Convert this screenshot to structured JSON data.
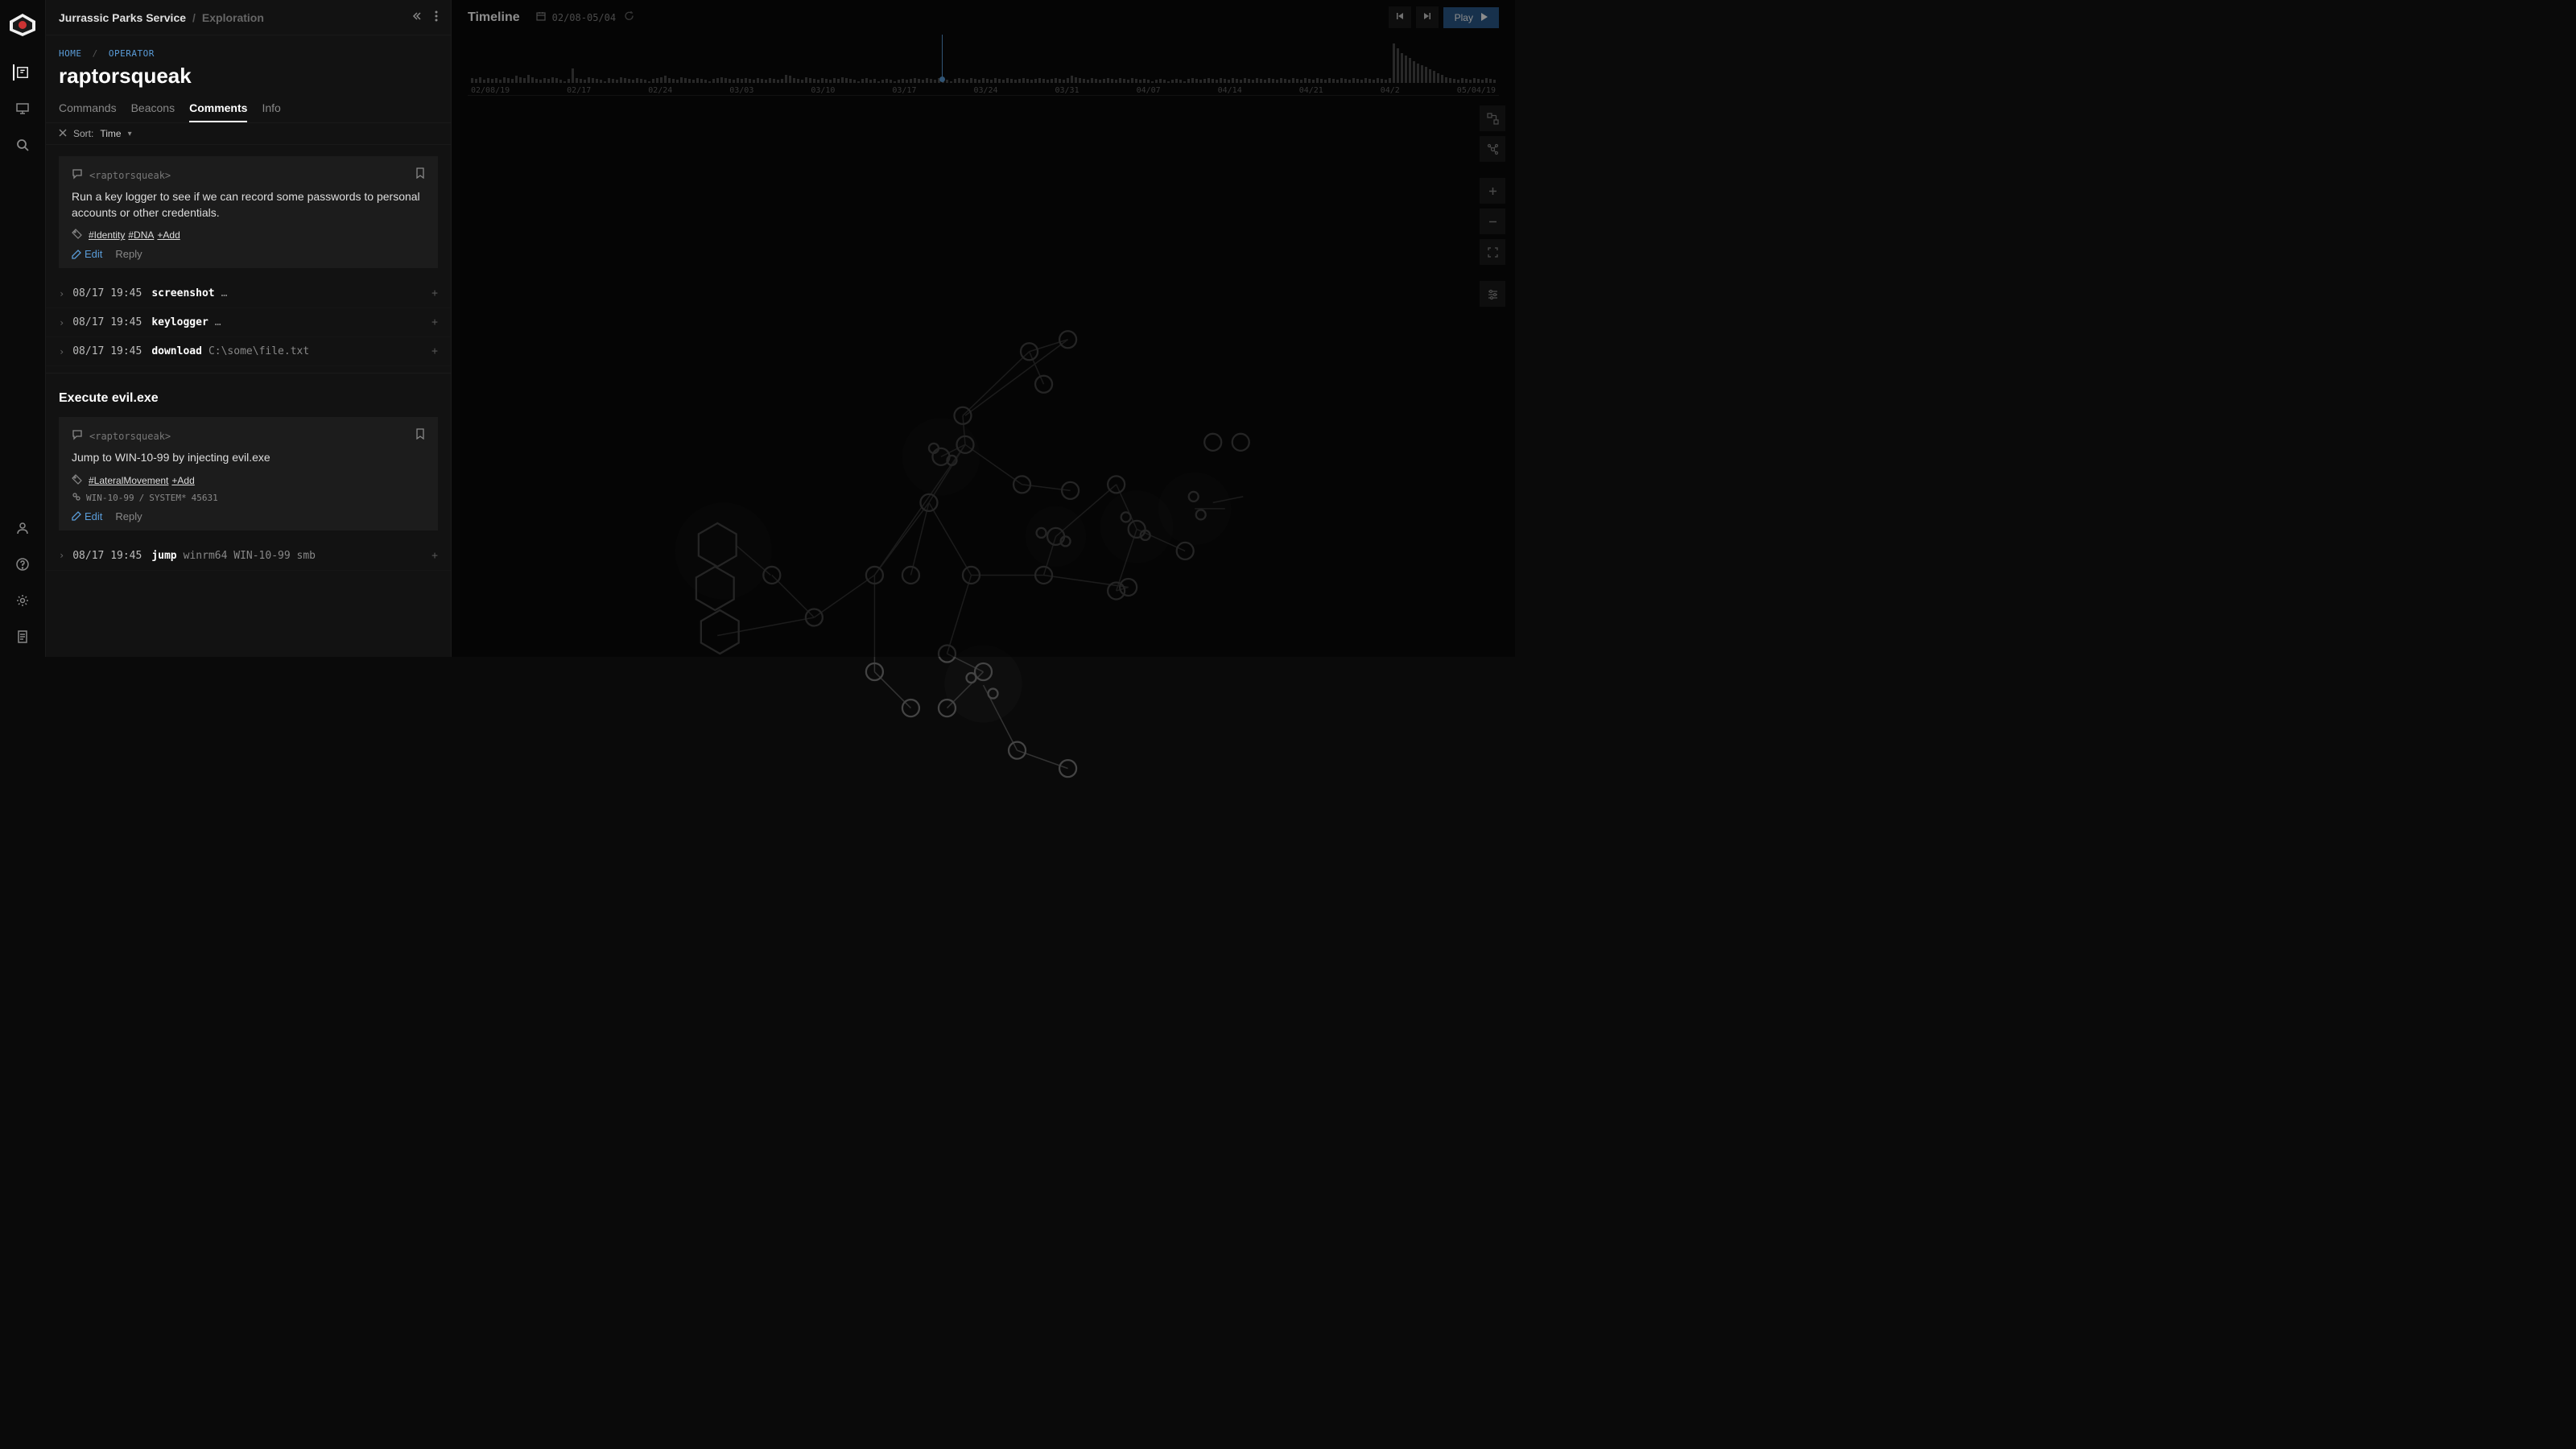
{
  "breadcrumb": {
    "org": "Jurrassic Parks Service",
    "sep": "/",
    "view": "Exploration"
  },
  "crumbs": {
    "home": "HOME",
    "sep": "/",
    "operator": "OPERATOR"
  },
  "page_title": "raptorsqueak",
  "tabs": {
    "items": [
      "Commands",
      "Beacons",
      "Comments",
      "Info"
    ],
    "active": 2
  },
  "sort": {
    "label": "Sort:",
    "value": "Time"
  },
  "comments": [
    {
      "author": "<raptorsqueak>",
      "body": "Run a key logger to see if we can record some passwords to personal accounts or other credentials.",
      "tags": [
        "#Identity",
        "#DNA"
      ],
      "add_tag": "+Add",
      "edit": "Edit",
      "reply": "Reply",
      "meta": null
    },
    {
      "author": "<raptorsqueak>",
      "body": "Jump to WIN-10-99 by injecting evil.exe",
      "tags": [
        "#LateralMovement"
      ],
      "add_tag": "+Add",
      "edit": "Edit",
      "reply": "Reply",
      "meta": {
        "host": "WIN-10-99",
        "sep": "/",
        "system": "SYSTEM*",
        "pid": "45631"
      }
    }
  ],
  "log_rows": [
    {
      "ts": "08/17 19:45",
      "cmd": "screenshot",
      "args": "…"
    },
    {
      "ts": "08/17 19:45",
      "cmd": "keylogger",
      "args": "…"
    },
    {
      "ts": "08/17 19:45",
      "cmd": "download",
      "args": "C:\\some\\file.txt"
    }
  ],
  "section2": {
    "title": "Execute evil.exe"
  },
  "log_rows2": [
    {
      "ts": "08/17 19:45",
      "cmd": "jump",
      "args": "winrm64 WIN-10-99 smb"
    }
  ],
  "timeline": {
    "title": "Timeline",
    "range": "02/08-05/04",
    "play": "Play",
    "ticks": [
      "02/08/19",
      "02/17",
      "02/24",
      "03/03",
      "03/10",
      "03/17",
      "03/24",
      "03/31",
      "04/07",
      "04/14",
      "04/21",
      "04/2",
      "05/04/19"
    ]
  },
  "chart_data": {
    "type": "bar",
    "title": "Activity timeline",
    "xlabel": "",
    "ylabel": "",
    "ylim": [
      0,
      45
    ],
    "categories_visible": [
      "02/08/19",
      "02/17",
      "02/24",
      "03/03",
      "03/10",
      "03/17",
      "03/24",
      "03/31",
      "04/07",
      "04/14",
      "04/21",
      "04/2",
      "05/04/19"
    ],
    "values": [
      5,
      4,
      6,
      3,
      5,
      4,
      5,
      3,
      6,
      5,
      4,
      7,
      6,
      5,
      8,
      6,
      4,
      3,
      5,
      4,
      6,
      5,
      3,
      2,
      4,
      15,
      5,
      4,
      3,
      6,
      5,
      4,
      3,
      2,
      5,
      4,
      3,
      6,
      5,
      4,
      3,
      5,
      4,
      3,
      2,
      4,
      5,
      6,
      7,
      5,
      4,
      3,
      6,
      5,
      4,
      3,
      5,
      4,
      3,
      2,
      4,
      5,
      6,
      5,
      4,
      3,
      5,
      4,
      5,
      4,
      3,
      5,
      4,
      3,
      5,
      4,
      3,
      4,
      8,
      7,
      5,
      4,
      3,
      6,
      5,
      4,
      3,
      5,
      4,
      3,
      5,
      4,
      6,
      5,
      4,
      3,
      2,
      4,
      5,
      3,
      4,
      2,
      3,
      4,
      3,
      2,
      3,
      4,
      3,
      4,
      5,
      4,
      3,
      5,
      4,
      3,
      5,
      4,
      3,
      2,
      4,
      5,
      4,
      3,
      5,
      4,
      3,
      5,
      4,
      3,
      5,
      4,
      3,
      5,
      4,
      3,
      4,
      5,
      4,
      3,
      4,
      5,
      4,
      3,
      4,
      5,
      4,
      3,
      5,
      7,
      6,
      5,
      4,
      3,
      5,
      4,
      3,
      4,
      5,
      4,
      3,
      5,
      4,
      3,
      5,
      4,
      3,
      4,
      3,
      2,
      3,
      4,
      3,
      2,
      3,
      4,
      3,
      2,
      4,
      5,
      4,
      3,
      4,
      5,
      4,
      3,
      5,
      4,
      3,
      5,
      4,
      3,
      5,
      4,
      3,
      5,
      4,
      3,
      5,
      4,
      3,
      5,
      4,
      3,
      5,
      4,
      3,
      5,
      4,
      3,
      5,
      4,
      3,
      5,
      4,
      3,
      5,
      4,
      3,
      5,
      4,
      3,
      5,
      4,
      3,
      5,
      4,
      3,
      5,
      40,
      35,
      30,
      28,
      25,
      22,
      20,
      18,
      16,
      14,
      12,
      10,
      8,
      6,
      5,
      4,
      3,
      5,
      4,
      3,
      5,
      4,
      3,
      5,
      4,
      3
    ],
    "scrubber_index": 117
  },
  "graph": {
    "edges": [
      [
        510,
        200,
        425,
        263
      ],
      [
        510,
        200,
        478,
        210
      ],
      [
        478,
        210,
        490,
        237
      ],
      [
        478,
        210,
        423,
        263
      ],
      [
        423,
        263,
        425,
        287
      ],
      [
        425,
        287,
        472,
        320
      ],
      [
        425,
        287,
        350,
        395
      ],
      [
        472,
        320,
        512,
        325
      ],
      [
        425,
        287,
        405,
        297
      ],
      [
        425,
        287,
        395,
        335
      ],
      [
        395,
        335,
        350,
        395
      ],
      [
        395,
        335,
        380,
        395
      ],
      [
        395,
        335,
        430,
        395
      ],
      [
        430,
        395,
        490,
        395
      ],
      [
        430,
        395,
        410,
        460
      ],
      [
        490,
        395,
        560,
        405
      ],
      [
        490,
        395,
        500,
        363
      ],
      [
        500,
        363,
        550,
        320
      ],
      [
        550,
        320,
        567,
        357
      ],
      [
        567,
        357,
        607,
        375
      ],
      [
        567,
        357,
        550,
        408
      ],
      [
        550,
        408,
        560,
        405
      ],
      [
        350,
        395,
        300,
        430
      ],
      [
        300,
        430,
        265,
        395
      ],
      [
        264,
        395,
        235,
        370
      ],
      [
        300,
        430,
        220,
        445
      ],
      [
        410,
        460,
        440,
        475
      ],
      [
        440,
        475,
        410,
        505
      ],
      [
        440,
        486,
        468,
        540
      ],
      [
        468,
        540,
        510,
        555
      ],
      [
        350,
        395,
        350,
        475
      ],
      [
        350,
        475,
        380,
        505
      ],
      [
        615,
        340,
        640,
        340
      ],
      [
        630,
        335,
        655,
        330
      ]
    ],
    "halos": [
      [
        405,
        297,
        32
      ],
      [
        567,
        355,
        30
      ],
      [
        440,
        485,
        32
      ],
      [
        225,
        375,
        40
      ],
      [
        615,
        340,
        30
      ],
      [
        500,
        363,
        25
      ]
    ],
    "nodes": [
      [
        510,
        200,
        7
      ],
      [
        478,
        210,
        7
      ],
      [
        490,
        237,
        7
      ],
      [
        423,
        263,
        7
      ],
      [
        425,
        287,
        7
      ],
      [
        472,
        320,
        7
      ],
      [
        512,
        325,
        7
      ],
      [
        405,
        297,
        7
      ],
      [
        395,
        335,
        7
      ],
      [
        430,
        395,
        7
      ],
      [
        380,
        395,
        7
      ],
      [
        350,
        395,
        7
      ],
      [
        490,
        395,
        7
      ],
      [
        500,
        363,
        7
      ],
      [
        550,
        320,
        7
      ],
      [
        567,
        357,
        7
      ],
      [
        607,
        375,
        7
      ],
      [
        550,
        408,
        7
      ],
      [
        560,
        405,
        7
      ],
      [
        300,
        430,
        7
      ],
      [
        265,
        395,
        7
      ],
      [
        410,
        460,
        7
      ],
      [
        440,
        475,
        7
      ],
      [
        410,
        505,
        7
      ],
      [
        468,
        540,
        7
      ],
      [
        510,
        555,
        7
      ],
      [
        350,
        475,
        7
      ],
      [
        380,
        505,
        7
      ],
      [
        630,
        285,
        7
      ],
      [
        653,
        285,
        7
      ],
      [
        399,
        290,
        4
      ],
      [
        414,
        300,
        4
      ],
      [
        558,
        347,
        4
      ],
      [
        574,
        362,
        4
      ],
      [
        430,
        480,
        4
      ],
      [
        448,
        493,
        4
      ],
      [
        614,
        330,
        4
      ],
      [
        620,
        345,
        4
      ],
      [
        488,
        360,
        4
      ],
      [
        508,
        367,
        4
      ]
    ],
    "hexes": [
      [
        220,
        370,
        18
      ],
      [
        218,
        406,
        18
      ],
      [
        222,
        442,
        18
      ]
    ]
  }
}
